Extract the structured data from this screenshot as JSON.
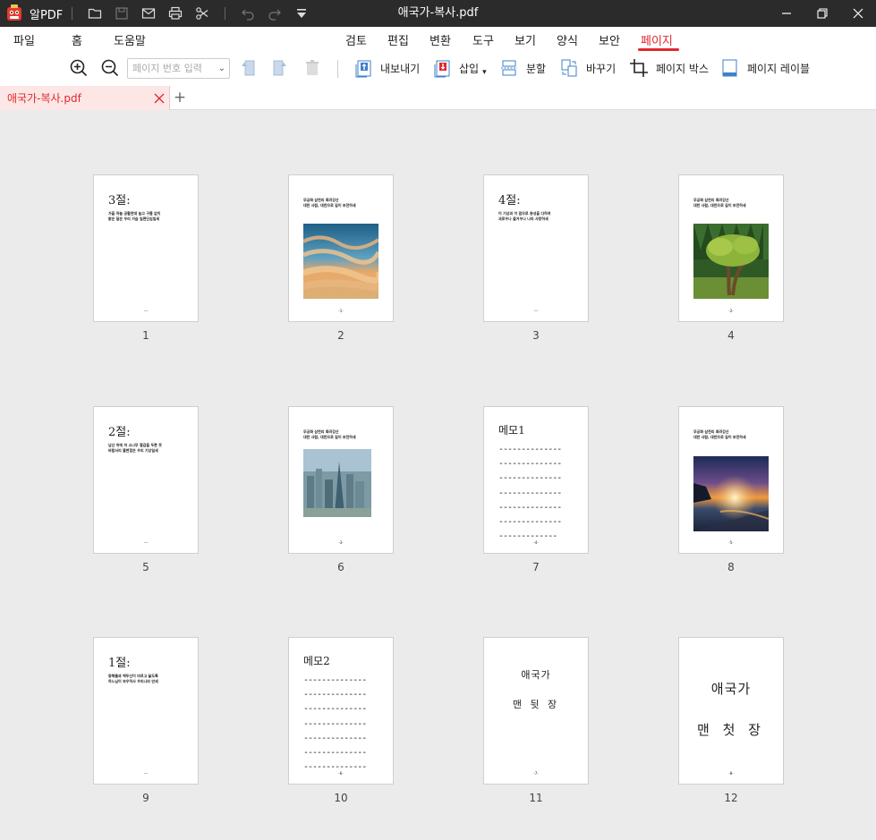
{
  "window": {
    "app_name": "알PDF",
    "title": "애국가-복사.pdf"
  },
  "menu": {
    "left": [
      "파일",
      "홈",
      "도움말"
    ],
    "right": [
      "검토",
      "편집",
      "변환",
      "도구",
      "보기",
      "양식",
      "보안",
      "페이지"
    ],
    "active": "페이지"
  },
  "toolbar": {
    "page_input_placeholder": "페이지 번호 입력",
    "export_label": "내보내기",
    "insert_label": "삽입",
    "split_label": "분할",
    "replace_label": "바꾸기",
    "pagebox_label": "페이지 박스",
    "pagelabel_label": "페이지 레이블"
  },
  "tab": {
    "name": "애국가-복사.pdf",
    "new_tab_symbol": "+"
  },
  "pages": [
    {
      "num": "1",
      "kind": "text",
      "heading": "3절:",
      "lines": [
        "가을 하늘 공활한데 높고 구름 없이",
        "밝은 달은 우리 가슴 일편단심일세"
      ],
      "footer": "---"
    },
    {
      "num": "2",
      "kind": "image",
      "caption": [
        "무궁화 삼천리 화려강산",
        "대한 사람, 대한으로 길이 보전하세"
      ],
      "image": "sky",
      "footer": "-1-"
    },
    {
      "num": "3",
      "kind": "text",
      "heading": "4절:",
      "lines": [
        "이 기상과 이 맘으로 충성을 다하여",
        "괴로우나 즐거우나 나라 사랑하세"
      ],
      "footer": "---"
    },
    {
      "num": "4",
      "kind": "image",
      "caption": [
        "무궁화 삼천리 화려강산",
        "대한 사람, 대한으로 길이 보전하세"
      ],
      "image": "tree",
      "footer": "-2-"
    },
    {
      "num": "5",
      "kind": "text",
      "heading": "2절:",
      "lines": [
        "남산 위에 저 소나무 철갑을 두른 듯",
        "바람서리 불변함은 우리 기상일세"
      ],
      "footer": "---"
    },
    {
      "num": "6",
      "kind": "image",
      "caption": [
        "무궁화 삼천리 화려강산",
        "대한 사람, 대한으로 길이 보전하세"
      ],
      "image": "city",
      "footer": "-3-"
    },
    {
      "num": "7",
      "kind": "memo",
      "title": "메모1",
      "footer": "-4-"
    },
    {
      "num": "8",
      "kind": "image",
      "caption": [
        "무궁화 삼천리 화려강산",
        "대한 사람, 대한으로 길이 보전하세"
      ],
      "image": "sunset",
      "footer": "-5-"
    },
    {
      "num": "9",
      "kind": "text",
      "heading": "1절:",
      "lines": [
        "동해물과 백두산이 마르고 닳도록",
        "하느님이 보우하사 우리나라 만세"
      ],
      "footer": "---"
    },
    {
      "num": "10",
      "kind": "memo",
      "title": "메모2",
      "footer": "-6-"
    },
    {
      "num": "11",
      "kind": "cover",
      "title": "애국가",
      "subtitle": "맨 뒷 장",
      "footer": "-7-"
    },
    {
      "num": "12",
      "kind": "cover",
      "title": "애국가",
      "subtitle": "맨 첫 장",
      "footer": "-8-"
    }
  ],
  "colors": {
    "accent": "#e0282e",
    "titlebar": "#2b2b2b",
    "background": "#ebebeb",
    "active_tab": "#fde6e6"
  }
}
